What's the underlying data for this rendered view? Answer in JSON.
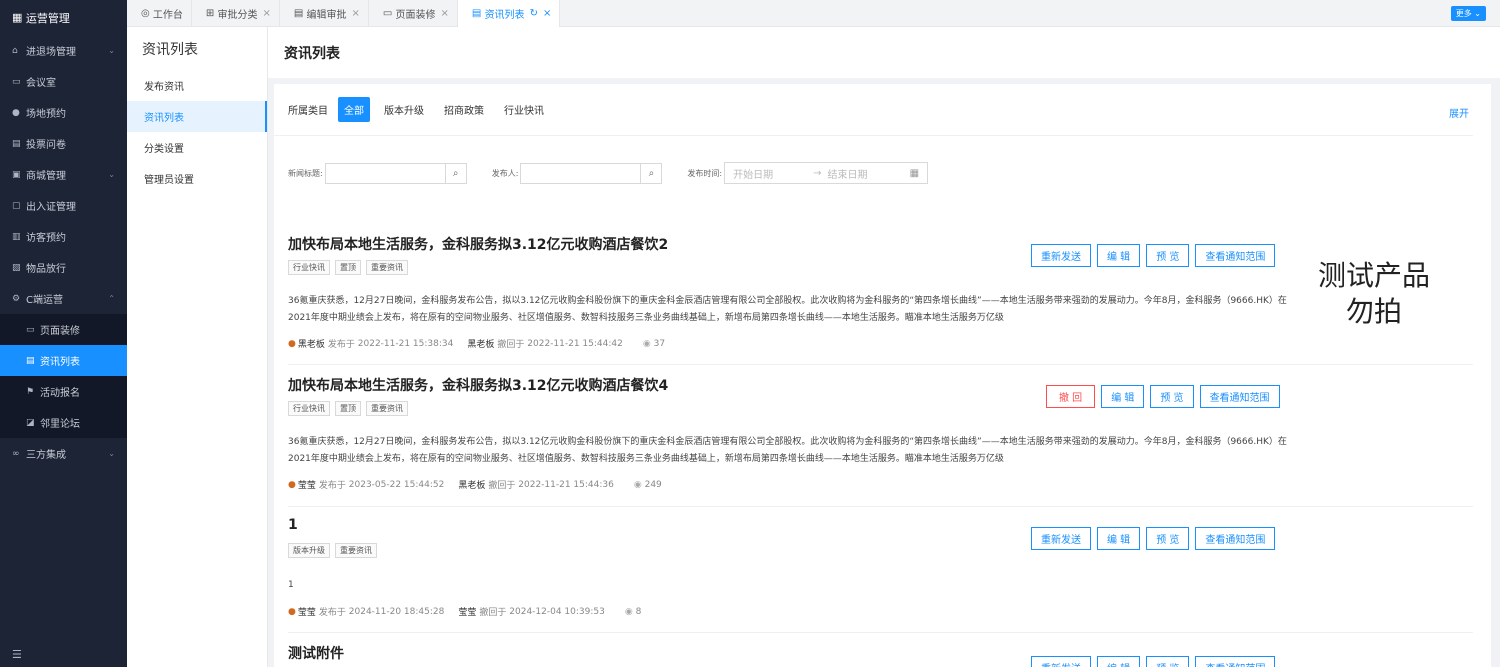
{
  "sidebar": {
    "header": "运营管理",
    "items": [
      {
        "label": "进退场管理",
        "icon": "home-icon",
        "chevron": true
      },
      {
        "label": "会议室",
        "icon": "monitor-icon"
      },
      {
        "label": "场地预约",
        "icon": "user-icon"
      },
      {
        "label": "投票问卷",
        "icon": "document-icon"
      },
      {
        "label": "商城管理",
        "icon": "shop-icon",
        "chevron": true
      },
      {
        "label": "出入证管理",
        "icon": "card-icon"
      },
      {
        "label": "访客预约",
        "icon": "visitor-icon"
      },
      {
        "label": "物品放行",
        "icon": "box-icon"
      },
      {
        "label": "C端运营",
        "icon": "gear-icon",
        "chevron": true
      }
    ],
    "sub_items": [
      {
        "label": "页面装修",
        "icon": "layout-icon"
      },
      {
        "label": "资讯列表",
        "icon": "list-icon"
      },
      {
        "label": "活动报名",
        "icon": "flag-icon"
      },
      {
        "label": "邻里论坛",
        "icon": "chat-icon"
      }
    ],
    "after_items": [
      {
        "label": "三方集成",
        "icon": "link-icon",
        "chevron": true
      }
    ]
  },
  "tabs": [
    {
      "label": "工作台",
      "icon": "dashboard-icon",
      "closable": false
    },
    {
      "label": "审批分类",
      "icon": "grid-icon",
      "closable": true
    },
    {
      "label": "编辑审批",
      "icon": "edit-icon",
      "closable": true
    },
    {
      "label": "页面装修",
      "icon": "layout-icon",
      "closable": true
    },
    {
      "label": "资讯列表",
      "icon": "list-icon",
      "closable": true,
      "active": true
    }
  ],
  "more_label": "更多",
  "subnav": {
    "title": "资讯列表",
    "items": [
      "发布资讯",
      "资讯列表",
      "分类设置",
      "管理员设置"
    ]
  },
  "page_title": "资讯列表",
  "filter": {
    "category_label": "所属类目",
    "categories": [
      "全部",
      "版本升级",
      "招商政策",
      "行业快讯"
    ],
    "expand": "展开",
    "news_title_label": "新闻标题:",
    "publisher_label": "发布人:",
    "publish_time_label": "发布时间:",
    "start_date_placeholder": "开始日期",
    "end_date_placeholder": "结束日期",
    "date_separator": "→"
  },
  "news": [
    {
      "title": "加快布局本地生活服务，金科服务拟3.12亿元收购酒店餐饮2",
      "tags": [
        "行业快讯",
        "置顶",
        "重要资讯"
      ],
      "body": "36氪重庆获悉，12月27日晚间，金科服务发布公告，拟以3.12亿元收购金科股份旗下的重庆金科金辰酒店管理有限公司全部股权。此次收购将为金科服务的“第四条增长曲线”——本地生活服务带来强劲的发展动力。今年8月，金科服务（9666.HK）在2021年度中期业绩会上发布，将在原有的空间物业服务、社区增值服务、数智科技服务三条业务曲线基础上，新增布局第四条增长曲线——本地生活服务。瞄准本地生活服务万亿级",
      "publisher": "黑老板",
      "publish_label": "发布于",
      "publish_time": "2022-11-21 15:38:34",
      "revoker": "黑老板",
      "revoke_label": "撤回于",
      "revoke_time": "2022-11-21 15:44:42",
      "views": "37",
      "actions": [
        "重新发送",
        "编 辑",
        "预 览",
        "查看通知范围"
      ]
    },
    {
      "title": "加快布局本地生活服务，金科服务拟3.12亿元收购酒店餐饮4",
      "tags": [
        "行业快讯",
        "置顶",
        "重要资讯"
      ],
      "body": "36氪重庆获悉，12月27日晚间，金科服务发布公告，拟以3.12亿元收购金科股份旗下的重庆金科金辰酒店管理有限公司全部股权。此次收购将为金科服务的“第四条增长曲线”——本地生活服务带来强劲的发展动力。今年8月，金科服务（9666.HK）在2021年度中期业绩会上发布，将在原有的空间物业服务、社区增值服务、数智科技服务三条业务曲线基础上，新增布局第四条增长曲线——本地生活服务。瞄准本地生活服务万亿级",
      "publisher": "莹莹",
      "publish_label": "发布于",
      "publish_time": "2023-05-22 15:44:52",
      "revoker": "黑老板",
      "revoke_label": "撤回于",
      "revoke_time": "2022-11-21 15:44:36",
      "views": "249",
      "actions": [
        "撤 回",
        "编 辑",
        "预 览",
        "查看通知范围"
      ]
    },
    {
      "title": "1",
      "tags": [
        "版本升级",
        "重要资讯"
      ],
      "body": "1",
      "publisher": "莹莹",
      "publish_label": "发布于",
      "publish_time": "2024-11-20 18:45:28",
      "revoker": "莹莹",
      "revoke_label": "撤回于",
      "revoke_time": "2024-12-04 10:39:53",
      "views": "8",
      "actions": [
        "重新发送",
        "编 辑",
        "预 览",
        "查看通知范围"
      ]
    },
    {
      "title": "测试附件",
      "tags": [],
      "body": "",
      "actions": [
        "重新发送",
        "编 辑",
        "预 览",
        "查看通知范围"
      ]
    }
  ],
  "watermark": {
    "line1": "测试产品",
    "line2": "勿拍"
  },
  "colors": {
    "accent": "#1890ff",
    "sidebar": "#1d2436",
    "danger": "#ff4d4f"
  }
}
